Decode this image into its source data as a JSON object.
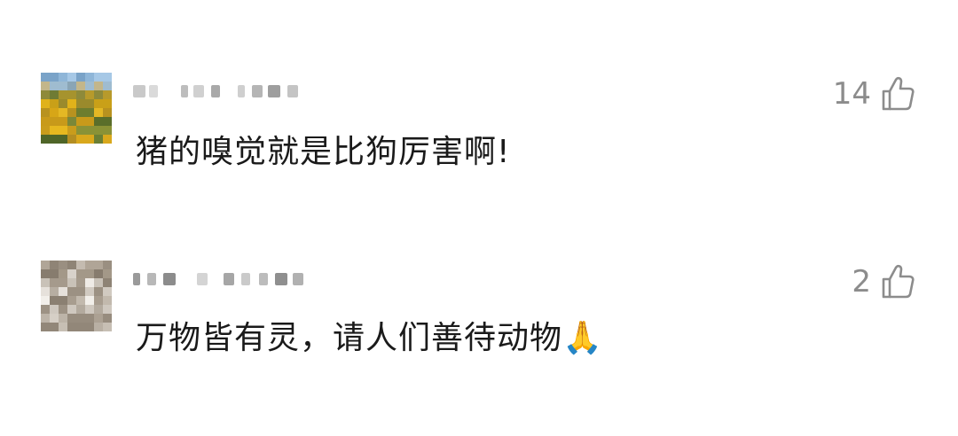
{
  "comments": [
    {
      "username": "",
      "likes": "14",
      "text": "猪的嗅觉就是比狗厉害啊!",
      "avatar": "blurred-avatar"
    },
    {
      "username": "",
      "likes": "2",
      "text": "万物皆有灵，请人们善待动物🙏",
      "avatar": "blurred-avatar"
    }
  ],
  "icons": {
    "like": "thumbs-up-icon"
  },
  "colors": {
    "like_icon": "#8c8c8c",
    "text": "#1a1a1a"
  }
}
